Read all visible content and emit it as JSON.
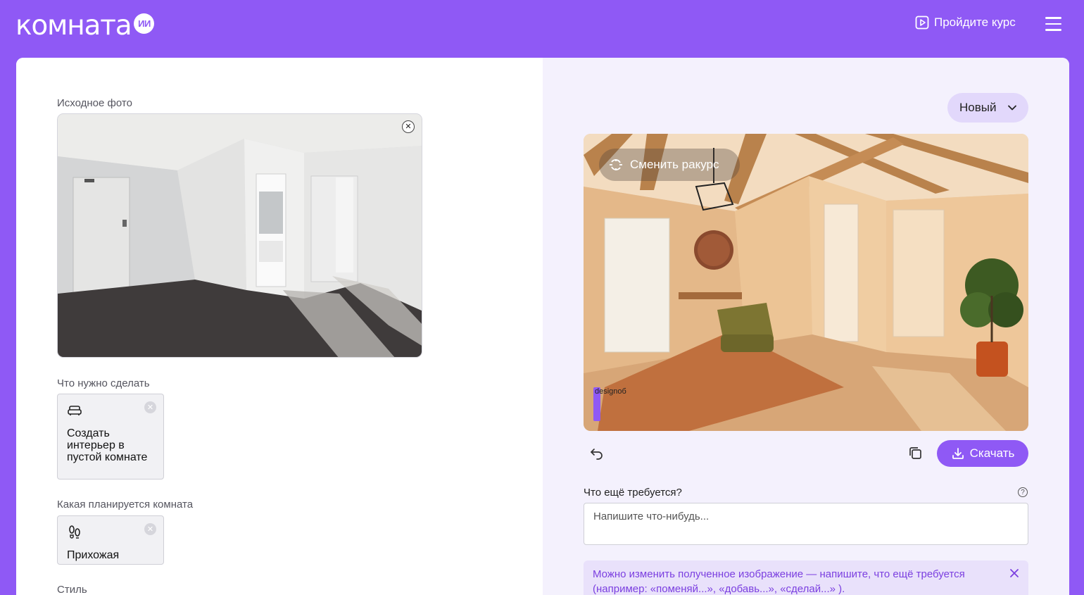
{
  "header": {
    "logo_word": "комната",
    "logo_badge": "ИИ",
    "course_label": "Пройдите курс"
  },
  "left": {
    "source_label": "Исходное фото",
    "task_label": "Что нужно сделать",
    "task_option": "Создать интерьер в пустой комнате",
    "room_label": "Какая планируется комната",
    "room_option": "Прихожая",
    "style_label": "Стиль"
  },
  "right": {
    "version_selected": "Новый",
    "angle_button": "Сменить ракурс",
    "watermark": "designоб",
    "download_label": "Скачать",
    "request_label": "Что ещё требуется?",
    "request_placeholder": "Напишите что-нибудь...",
    "hint_text": "Можно изменить полученное изображение — напишите, что ещё требуется (например: «поменяй...», «добавь...», «сделай...» )."
  },
  "colors": {
    "brand": "#8f59f5",
    "panel": "#f4f1fd",
    "hint_bg": "#e9e1fb",
    "hint_text": "#7b3fe0"
  }
}
